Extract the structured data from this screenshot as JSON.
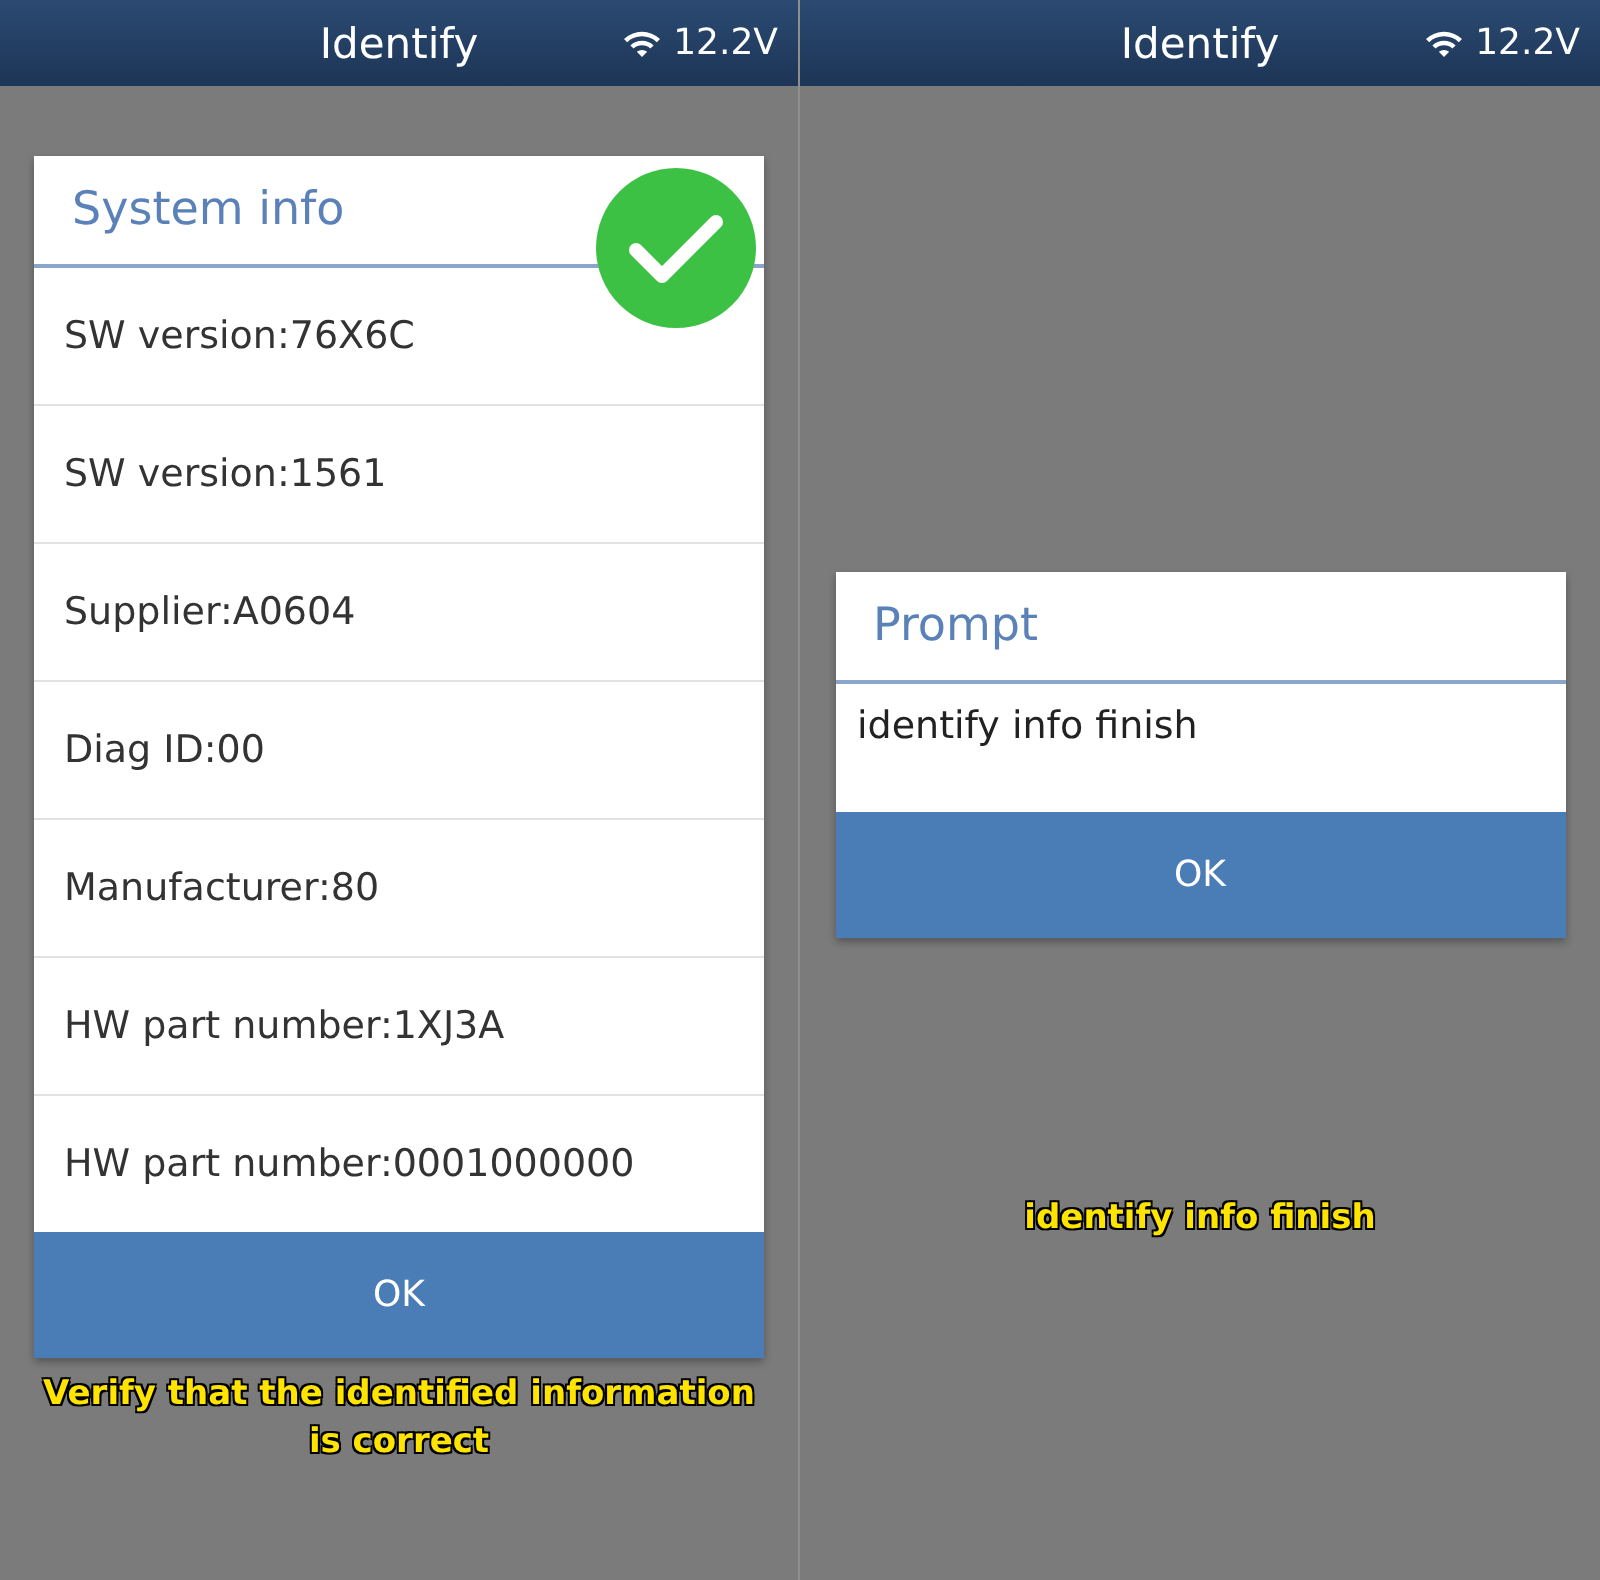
{
  "screens": [
    {
      "header": {
        "title": "Identify",
        "voltage": "12.2V"
      },
      "dialog": {
        "kind": "list",
        "title": "System info",
        "check_badge": true,
        "rows": [
          "SW version:76X6C",
          "SW version:1561",
          "Supplier:A0604",
          "Diag ID:00",
          "Manufacturer:80",
          "HW part number:1XJ3A",
          "HW part number:0001000000"
        ],
        "button": "OK"
      },
      "caption": "Verify that the identified information is correct"
    },
    {
      "header": {
        "title": "Identify",
        "voltage": "12.2V"
      },
      "dialog": {
        "kind": "prompt",
        "title": "Prompt",
        "check_badge": false,
        "rows": [
          "identify info finish"
        ],
        "button": "OK"
      },
      "caption": "identify info finish"
    }
  ]
}
